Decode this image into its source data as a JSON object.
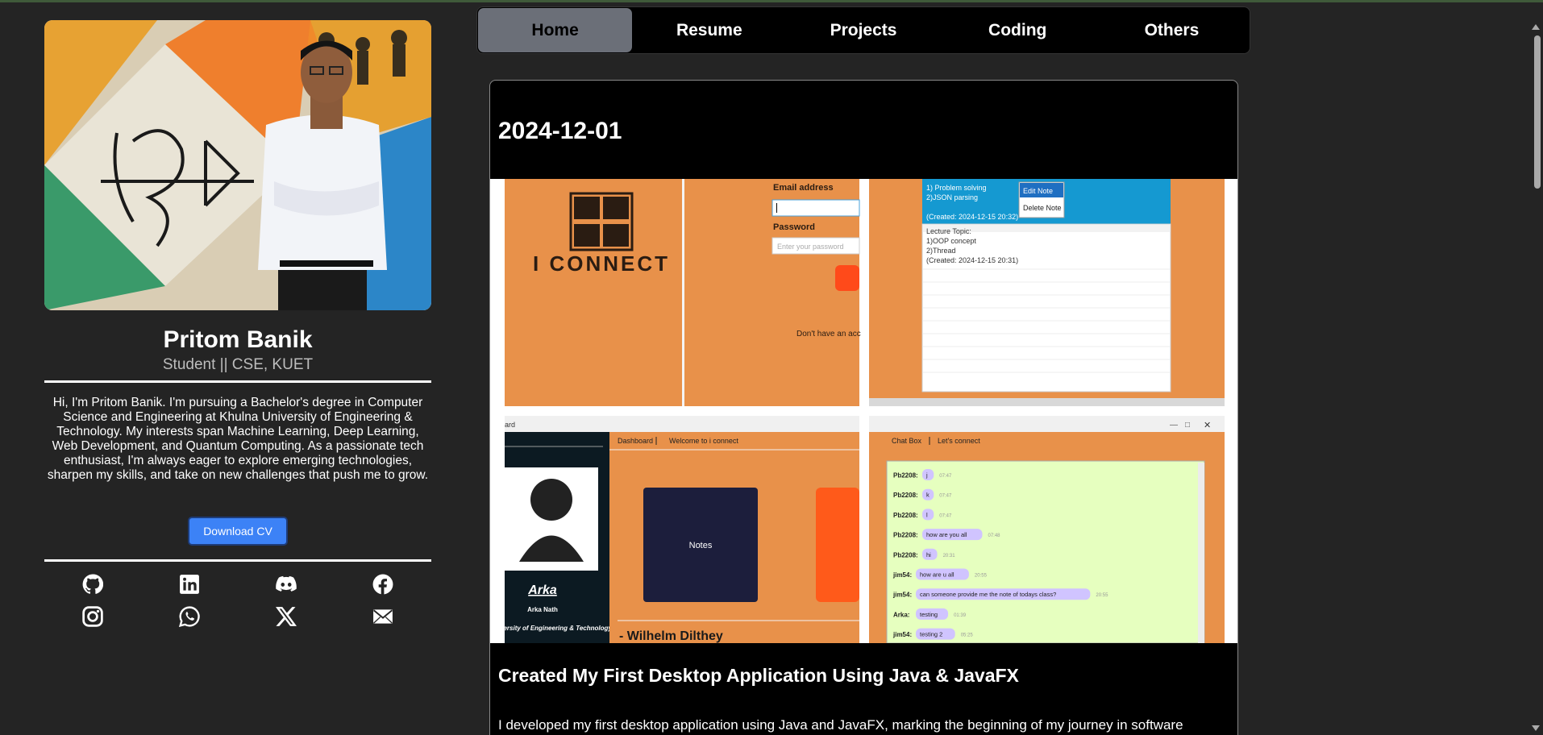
{
  "profile": {
    "name": "Pritom Banik",
    "role": "Student || CSE, KUET",
    "bio": "Hi, I'm Pritom Banik. I'm pursuing a Bachelor's degree in Computer Science and Engineering at Khulna University of Engineering & Technology. My interests span Machine Learning, Deep Learning, Web Development, and Quantum Computing. As a passionate tech enthusiast, I'm always eager to explore emerging technologies, sharpen my skills, and take on new challenges that push me to grow.",
    "download_label": "Download CV",
    "photo_icon": "profile-photo"
  },
  "socials": [
    {
      "icon": "github-icon"
    },
    {
      "icon": "linkedin-icon"
    },
    {
      "icon": "discord-icon"
    },
    {
      "icon": "facebook-icon"
    },
    {
      "icon": "instagram-icon"
    },
    {
      "icon": "whatsapp-icon"
    },
    {
      "icon": "x-icon"
    },
    {
      "icon": "mail-icon"
    }
  ],
  "nav": {
    "tabs": [
      {
        "label": "Home",
        "active": true
      },
      {
        "label": "Resume",
        "active": false
      },
      {
        "label": "Projects",
        "active": false
      },
      {
        "label": "Coding",
        "active": false
      },
      {
        "label": "Others",
        "active": false
      }
    ]
  },
  "post": {
    "date": "2024-12-01",
    "title": "Created My First Desktop Application Using Java & JavaFX",
    "text": "I developed my first desktop application using Java and JavaFX, marking the beginning of my journey in software",
    "screenshots": {
      "login": {
        "logo_text": "I CONNECT",
        "email_label": "Email address",
        "password_label": "Password",
        "password_placeholder": "Enter your password",
        "signup_text": "Don't have an acc"
      },
      "notes": {
        "note1": "1) Problem solving",
        "note2": "2)JSON parsing",
        "note3": "(Created: 2024-12-15 20:32)",
        "menu_edit": "Edit Note",
        "menu_delete": "Delete Note",
        "lecture": "Lecture Topic:",
        "lecture1": "1)OOP concept",
        "lecture2": "2)Thread",
        "lecture3": "(Created: 2024-12-15 20:31)"
      },
      "dashboard": {
        "window_title": "ard",
        "tab1": "Dashboard",
        "tab2": "Welcome to i connect",
        "user_name": "Arka",
        "user_full": "Arka Nath",
        "university": "University of Engineering & Technology",
        "notes_button": "Notes",
        "quote": "- Wilhelm Dilthey"
      },
      "chat": {
        "tab1": "Chat Box",
        "tab2": "Let's connect",
        "messages": [
          {
            "user": "Pb2208:",
            "text": "j",
            "time": "07:47"
          },
          {
            "user": "Pb2208:",
            "text": "k",
            "time": "07:47"
          },
          {
            "user": "Pb2208:",
            "text": "l",
            "time": "07:47"
          },
          {
            "user": "Pb2208:",
            "text": "how are you all",
            "time": "07:48"
          },
          {
            "user": "Pb2208:",
            "text": "hi",
            "time": "20:31"
          },
          {
            "user": "jim54:",
            "text": "how are u all",
            "time": "20:55"
          },
          {
            "user": "jim54:",
            "text": "can someone provide me the note of todays class?",
            "time": "20:55"
          },
          {
            "user": "Arka:",
            "text": "testing",
            "time": "01:39"
          },
          {
            "user": "jim54:",
            "text": "testing 2",
            "time": "05:25"
          }
        ]
      }
    }
  },
  "colors": {
    "background": "#242424",
    "accent": "#3c82f6",
    "active_tab": "#6b6f78",
    "app_orange": "#e8914a",
    "chat_bg": "#e6ffbf",
    "chat_bubble": "#d0c4ff"
  }
}
